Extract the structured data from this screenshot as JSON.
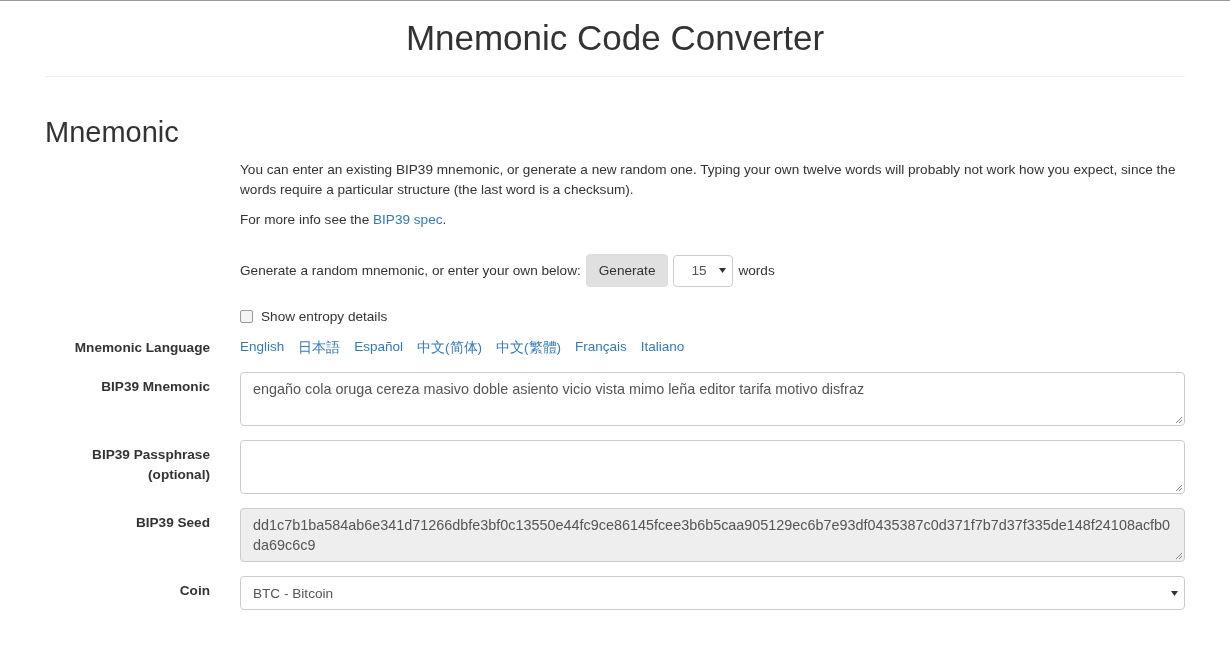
{
  "page_title": "Mnemonic Code Converter",
  "section_title": "Mnemonic",
  "intro": "You can enter an existing BIP39 mnemonic, or generate a new random one. Typing your own twelve words will probably not work how you expect, since the words require a particular structure (the last word is a checksum).",
  "more_info": {
    "prefix": "For more info see the ",
    "link": "BIP39 spec",
    "suffix": "."
  },
  "generate": {
    "label": "Generate a random mnemonic, or enter your own below:",
    "button": "Generate",
    "word_count": "15",
    "suffix": "words"
  },
  "entropy_details": {
    "label": "Show entropy details",
    "checked": false
  },
  "language": {
    "label": "Mnemonic Language",
    "options": [
      "English",
      "日本語",
      "Español",
      "中文(简体)",
      "中文(繁體)",
      "Français",
      "Italiano"
    ]
  },
  "fields": [
    {
      "kind": "textarea",
      "label": "BIP39 Mnemonic",
      "value": "engaño cola oruga cereza masivo doble asiento vicio vista mimo leña editor tarifa motivo disfraz",
      "readonly": false
    },
    {
      "kind": "textarea",
      "label": "BIP39 Passphrase (optional)",
      "readonly": false
    },
    {
      "kind": "textarea",
      "label": "BIP39 Seed",
      "value": "dd1c7b1ba584ab6e341d71266dbfe3bf0c13550e44fc9ce86145fcee3b6b5caa905129ec6b7e93df0435387c0d371f7b7d37f335de148f24108acfb0da69c6c9",
      "readonly": true
    },
    {
      "kind": "select",
      "label": "Coin",
      "value": "BTC - Bitcoin",
      "readonly": false
    }
  ]
}
